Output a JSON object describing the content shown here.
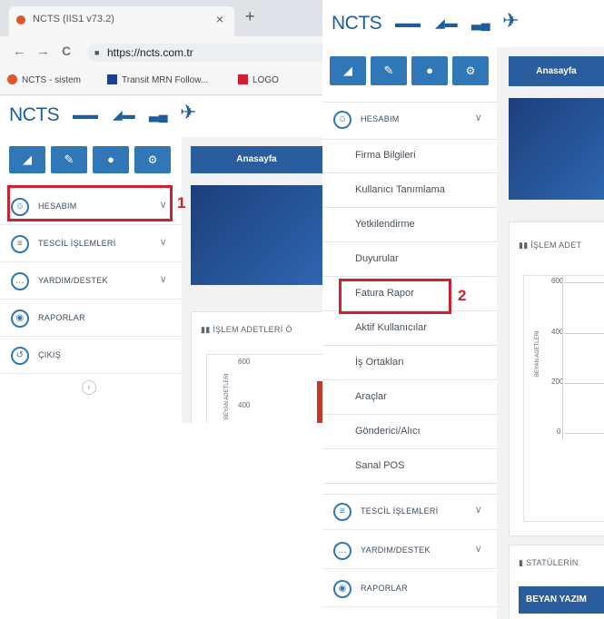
{
  "browser": {
    "tab_title": "NCTS (IIS1 v73.2)",
    "tab_close": "×",
    "new_tab": "+",
    "back": "←",
    "forward": "→",
    "reload": "C",
    "url": "https://ncts.com.tr",
    "bookmarks": [
      "NCTS - sistem",
      "Transit MRN Follow...",
      "LOGO"
    ]
  },
  "app": {
    "brand": "NCTS",
    "toolbar_icons": [
      "chart-icon",
      "pencil-icon",
      "users-icon",
      "settings-icon"
    ]
  },
  "left_panel": {
    "main_tab": "Anasayfa",
    "nav": [
      {
        "label": "HESABIM",
        "icon": "user-icon",
        "has_chevron": true
      },
      {
        "label": "TESCİL İŞLEMLERİ",
        "icon": "stack-icon",
        "has_chevron": true
      },
      {
        "label": "YARDIM/DESTEK",
        "icon": "chat-icon",
        "has_chevron": true
      },
      {
        "label": "RAPORLAR",
        "icon": "report-icon",
        "has_chevron": false
      },
      {
        "label": "ÇIKIŞ",
        "icon": "logout-icon",
        "has_chevron": false
      }
    ],
    "collapse": "‹",
    "card_title": "İŞLEM ADETLERİ Ö",
    "y_ticks": [
      "600",
      "400"
    ],
    "y_label": "BEYAN ADETLERİ"
  },
  "right_panel": {
    "main_tab": "Anasayfa",
    "nav_header": "HESABIM",
    "submenu": [
      "Firma Bilgileri",
      "Kullanıcı Tanımlama",
      "Yetkilendirme",
      "Duyurular",
      "Fatura Rapor",
      "Aktif Kullanıcılar",
      "İş Ortakları",
      "Araçlar",
      "Gönderici/Alıcı",
      "Sanal POS"
    ],
    "nav_after": [
      "TESCİL İŞLEMLERİ",
      "YARDIM/DESTEK",
      "RAPORLAR"
    ],
    "card_title": "İŞLEM ADET",
    "y_ticks": [
      "600",
      "400",
      "200",
      "0"
    ],
    "y_label": "BEYAN ADETLERİ",
    "status_title": "STATÜLERİN",
    "status_button": "BEYAN YAZIM"
  },
  "annotations": {
    "step1": "1",
    "step2": "2"
  },
  "colors": {
    "accent": "#2f77b6",
    "brand": "#1f5c9e",
    "highlight": "#d3202e"
  }
}
